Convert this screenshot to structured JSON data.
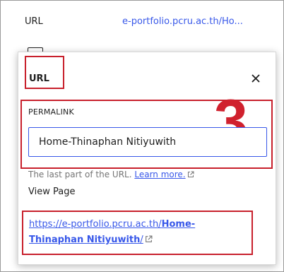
{
  "settings_row": {
    "label": "URL",
    "value": "e-portfolio.pcru.ac.th/Ho..."
  },
  "popover": {
    "title": "URL",
    "close_icon": "close-icon",
    "annotation_number": "3",
    "permalink_label": "PERMALINK",
    "slug_value": "Home-Thinaphan Nitiyuwith",
    "help_text": "The last part of the URL.",
    "help_link": "Learn more.",
    "view_page_label": "View Page",
    "url_line1_prefix": "https://e-portfolio.pcru.ac.th/",
    "url_line1_bold": "Home-",
    "url_line2_bold": "Thinaphan Nitiyuwith",
    "url_line2_suffix": "/",
    "external_icon": "external-link-icon"
  },
  "colors": {
    "accent": "#3858e9",
    "annotation_red": "#c8202c",
    "text": "#1e1e1e",
    "muted": "#757575"
  }
}
